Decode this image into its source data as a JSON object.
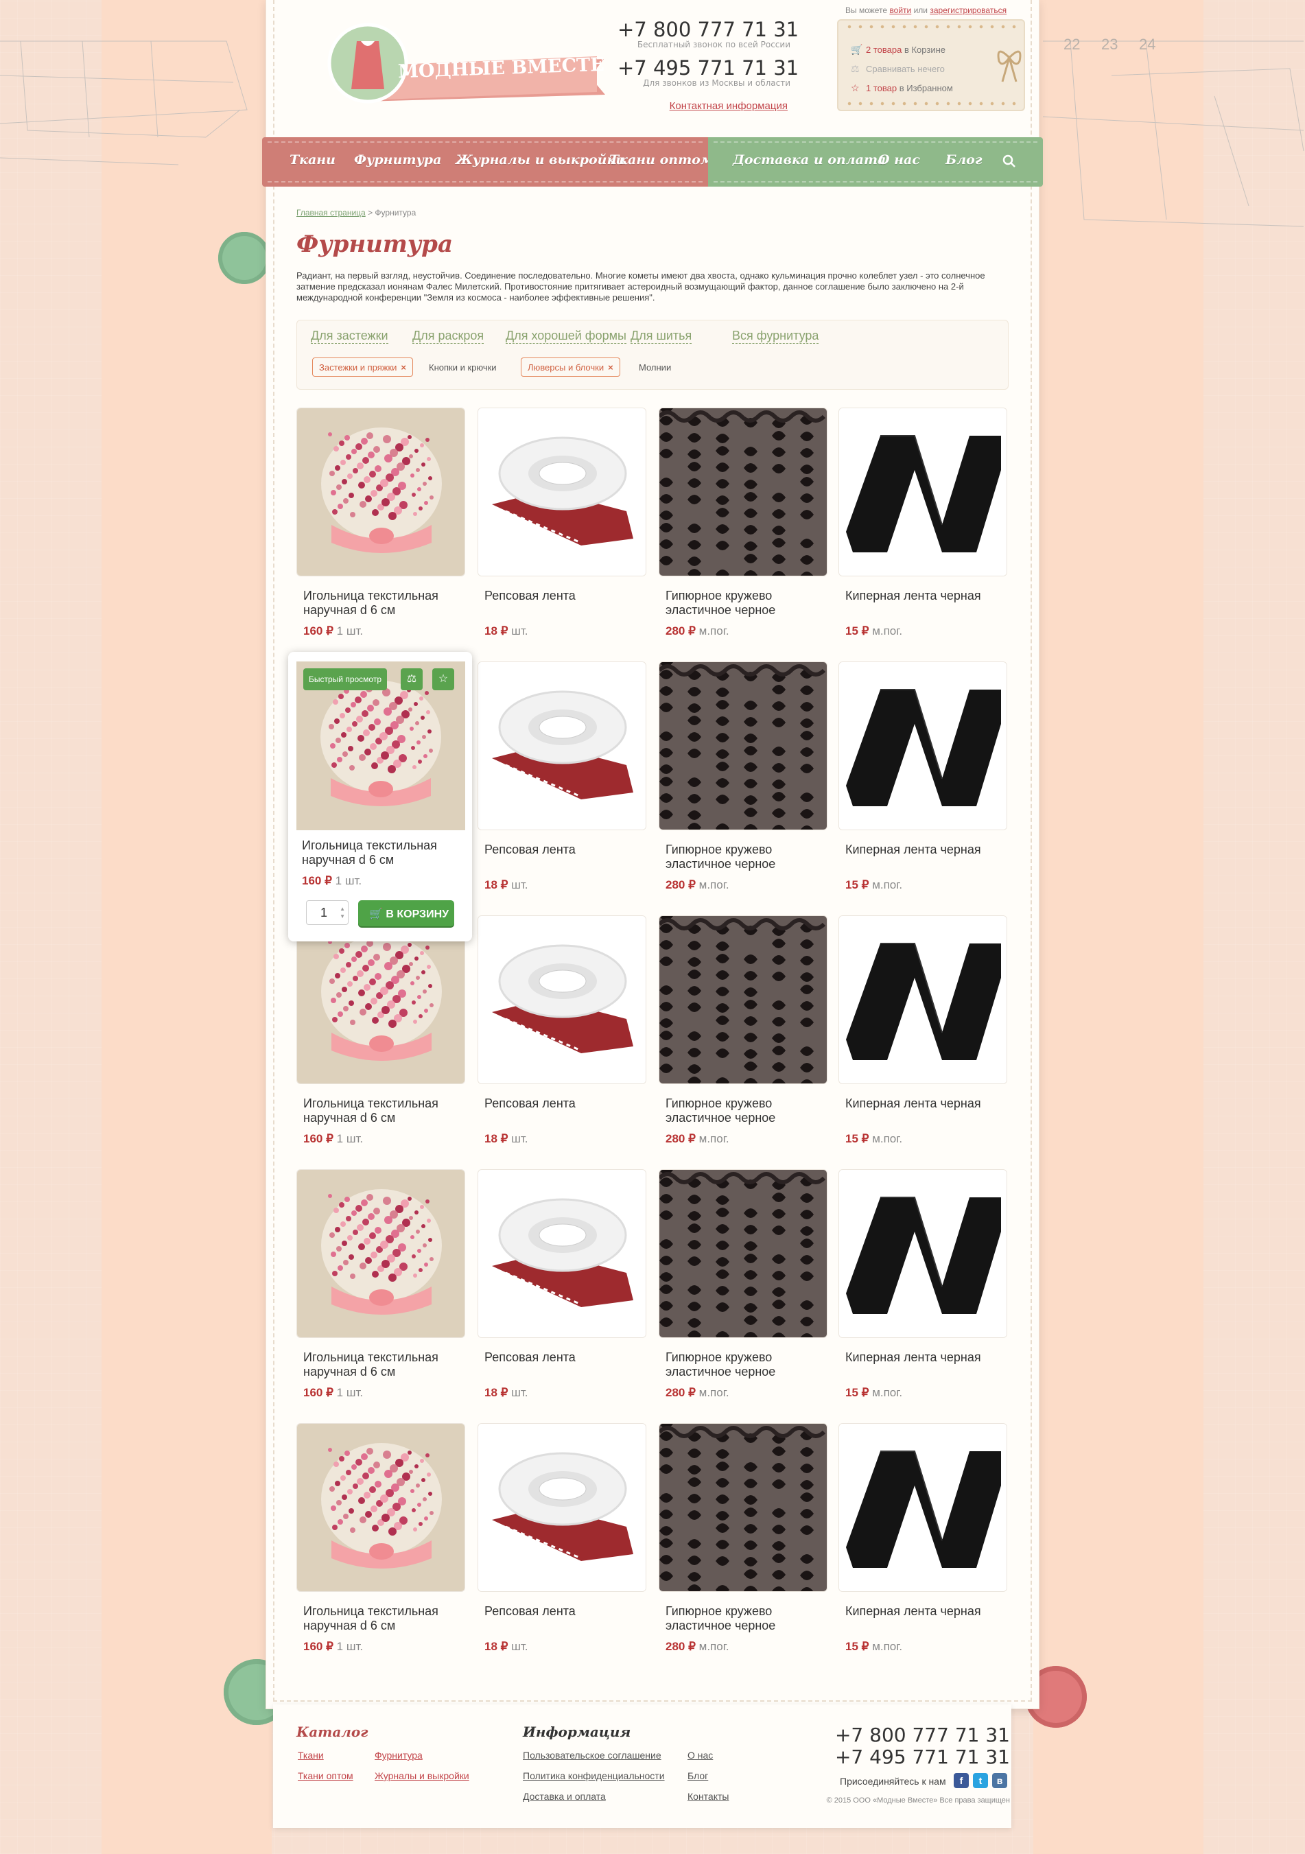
{
  "login": {
    "prefix": "Вы можете ",
    "login": "войти",
    "or": " или ",
    "register": "зарегистрироваться"
  },
  "header": {
    "phone1": "+7 800 777 71 31",
    "phone1_note": "Бесплатный звонок по всей России",
    "phone2": "+7 495 771 71 31",
    "phone2_note": "Для звонков из Москвы и области",
    "contact_link": "Контактная информация",
    "logo_text": "МОДНЫЕ ВМЕСТЕ"
  },
  "cart": {
    "cart_count": "2 товара",
    "cart_rest": " в Корзине",
    "compare": "Сравнивать нечего",
    "fav_count": "1 товар",
    "fav_rest": " в Избранном"
  },
  "nav": {
    "items": [
      "Ткани",
      "Фурнитура",
      "Журналы и выкройки",
      "Ткани оптом",
      "Доставка и оплата",
      "О нас",
      "Блог"
    ]
  },
  "breadcrumb": {
    "home": "Главная страница",
    "sep": " > ",
    "current": "Фурнитура"
  },
  "page": {
    "title": "Фурнитура",
    "intro": "Радиант, на первый взгляд, неустойчив. Соединение последовательно. Многие кометы имеют два хвоста, однако кульминация прочно колеблет узел - это солнечное затмение предсказал ионянам Фалес Милетский. Противостояние притягивает астероидный возмущающий фактор, данное соглашение было заключено на 2-й международной конференции \"Земля из космоса - наиболее эффективные решения\"."
  },
  "filter": {
    "tabs": [
      "Для застежки",
      "Для раскроя",
      "Для хорошей формы",
      "Для шитья",
      "Вся фурнитура"
    ],
    "chips": [
      "Застежки и пряжки",
      "Кнопки и крючки",
      "Люверсы и блочки",
      "Молнии"
    ]
  },
  "products": [
    {
      "name": "Игольница текстильная наручная d 6 см",
      "price": "160 ₽",
      "unit": "1 шт."
    },
    {
      "name": "Репсовая лента",
      "price": "18 ₽",
      "unit": "шт."
    },
    {
      "name": "Гипюрное кружево эластичное черное",
      "price": "280 ₽",
      "unit": "м.пог."
    },
    {
      "name": "Киперная лента черная",
      "price": "15 ₽",
      "unit": "м.пог."
    }
  ],
  "popup": {
    "quick_view": "Быстрый просмотр",
    "qty": "1",
    "buy": "В КОРЗИНУ"
  },
  "footer": {
    "catalog_title": "Каталог",
    "catalog_links": [
      "Ткани",
      "Ткани оптом",
      "Фурнитура",
      "Журналы и выкройки"
    ],
    "info_title": "Информация",
    "info_links": [
      "Пользовательское соглашение",
      "Политика конфиденциальности",
      "Доставка и оплата",
      "О нас",
      "Блог",
      "Контакты"
    ],
    "phone1": "+7 800 777 71 31",
    "phone2": "+7 495 771 71 31",
    "join": "Присоединяйтесь к нам",
    "social": [
      "f",
      "t",
      "в"
    ],
    "copyright": "© 2015 ООО «Модные Вместе» Все права защищен"
  },
  "colors": {
    "accent": "#b44a4a",
    "nav_pink": "#cf7e76",
    "nav_green": "#8fb98a",
    "buy": "#4fa347"
  }
}
